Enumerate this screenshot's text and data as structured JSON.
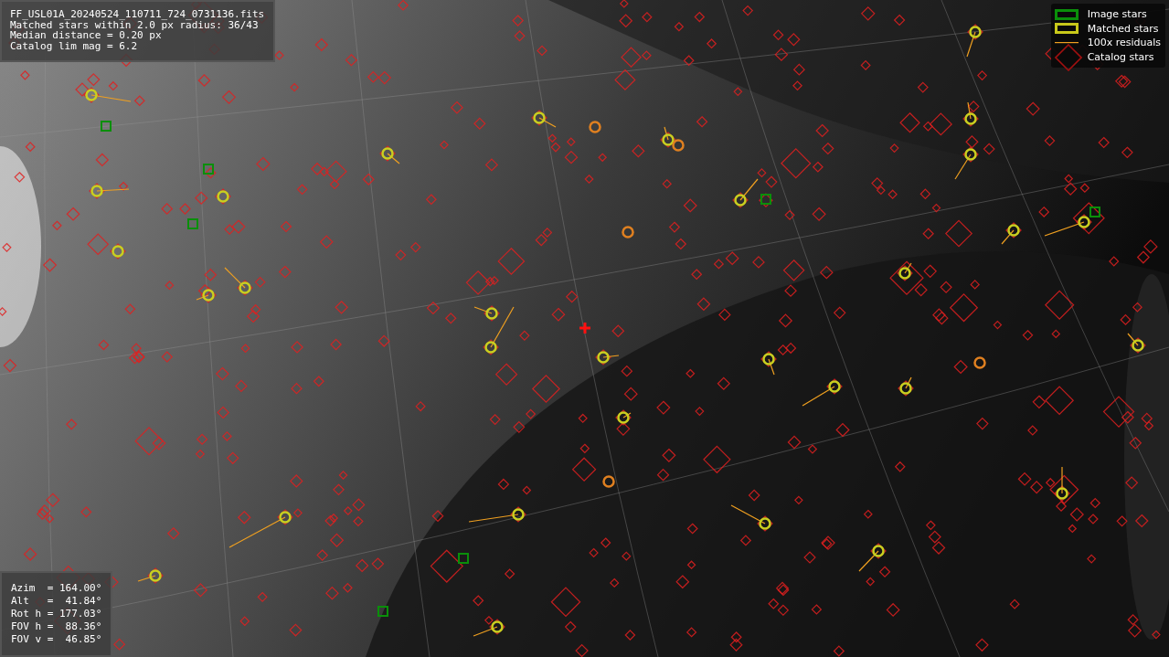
{
  "info_box": {
    "lines": [
      "FF_USL01A_20240524_110711_724_0731136.fits",
      "Matched stars within 2.0 px radius: 36/43",
      "Median distance = 0.20 px",
      "Catalog lim mag = 6.2"
    ]
  },
  "legend": [
    {
      "label": "Image stars"
    },
    {
      "kind": "matched",
      "label": "Matched stars"
    },
    {
      "kind": "residual",
      "label": "100x residuals"
    },
    {
      "kind": "catalog",
      "label": "Catalog stars"
    }
  ],
  "pointing_box": {
    "lines": [
      "Azim  = 164.00°",
      "Alt   =  41.84°",
      "Rot h = 177.03°",
      "FOV h =  88.36°",
      "FOV v =  46.85°"
    ]
  }
}
